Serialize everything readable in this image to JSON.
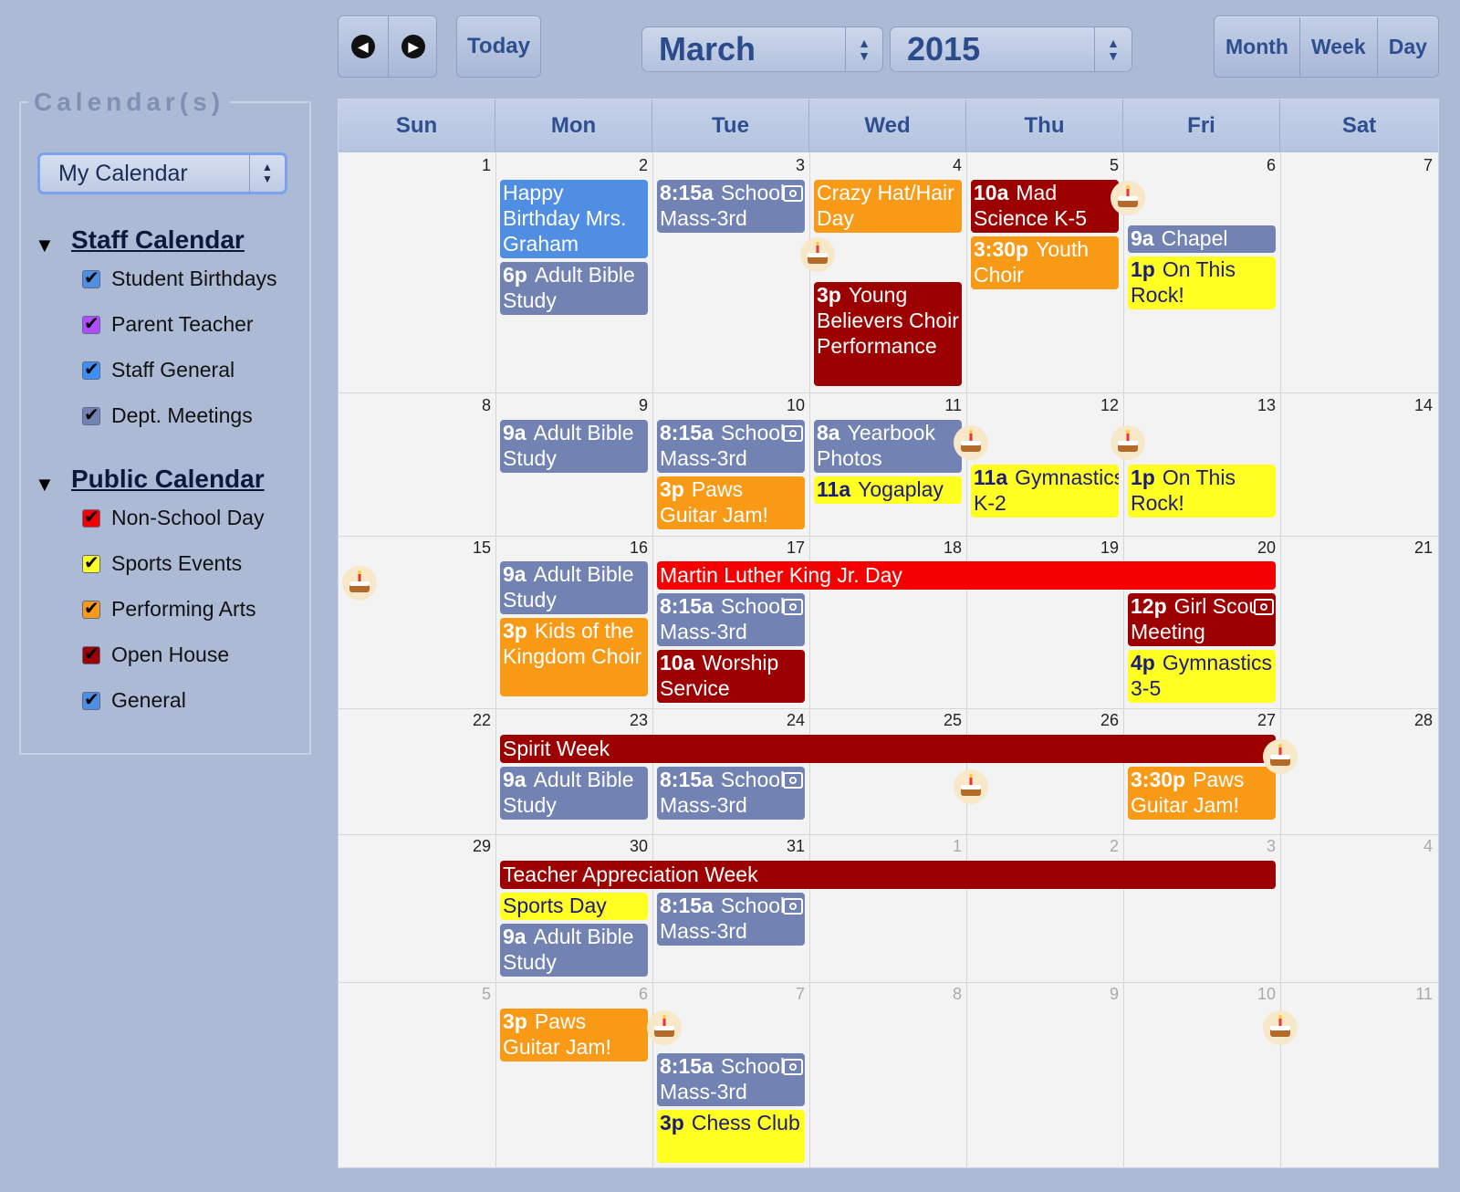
{
  "toolbar": {
    "prev_icon": "chevron-left-icon",
    "next_icon": "chevron-right-icon",
    "today_label": "Today",
    "month_value": "March",
    "year_value": "2015",
    "views": [
      "Month",
      "Week",
      "Day"
    ]
  },
  "sidebar": {
    "legend": "Calendar(s)",
    "calendar_select": "My Calendar",
    "groups": [
      {
        "title": "Staff Calendar",
        "items": [
          {
            "label": "Student Birthdays",
            "color": "#4f8ee3"
          },
          {
            "label": "Parent Teacher",
            "color": "#b14cff"
          },
          {
            "label": "Staff General",
            "color": "#3f8ef5"
          },
          {
            "label": "Dept. Meetings",
            "color": "#7182b3"
          }
        ]
      },
      {
        "title": "Public Calendar",
        "items": [
          {
            "label": "Non-School Day",
            "color": "#f40000"
          },
          {
            "label": "Sports Events",
            "color": "#ffff21"
          },
          {
            "label": "Performing Arts",
            "color": "#f99a16"
          },
          {
            "label": "Open House",
            "color": "#9c0000"
          },
          {
            "label": "General",
            "color": "#4f8ee3"
          }
        ]
      }
    ]
  },
  "calendar": {
    "weekdays": [
      "Sun",
      "Mon",
      "Tue",
      "Wed",
      "Thu",
      "Fri",
      "Sat"
    ],
    "weeks": [
      [
        "1",
        "2",
        "3",
        "4",
        "5",
        "6",
        "7"
      ],
      [
        "8",
        "9",
        "10",
        "11",
        "12",
        "13",
        "14"
      ],
      [
        "15",
        "16",
        "17",
        "18",
        "19",
        "20",
        "21"
      ],
      [
        "22",
        "23",
        "24",
        "25",
        "26",
        "27",
        "28"
      ],
      [
        "29",
        "30",
        "31",
        "1",
        "2",
        "3",
        "4"
      ],
      [
        "5",
        "6",
        "7",
        "8",
        "9",
        "10",
        "11"
      ]
    ],
    "events": {
      "w1_mon_1": {
        "time": "",
        "title": "Happy Birthday Mrs. Graham"
      },
      "w1_mon_2": {
        "time": "6p",
        "title": "Adult Bible Study"
      },
      "w1_tue_1": {
        "time": "8:15a",
        "title": "School Mass-3rd"
      },
      "w1_wed_1": {
        "time": "",
        "title": "Crazy Hat/Hair Day"
      },
      "w1_wed_2": {
        "time": "3p",
        "title": "Young Believers Choir Performance"
      },
      "w1_thu_1": {
        "time": "10a",
        "title": "Mad Science K-5"
      },
      "w1_thu_2": {
        "time": "3:30p",
        "title": "Youth Choir"
      },
      "w1_fri_1": {
        "time": "9a",
        "title": "Chapel"
      },
      "w1_fri_2": {
        "time": "1p",
        "title": "On This Rock!"
      },
      "w2_mon_1": {
        "time": "9a",
        "title": "Adult Bible Study"
      },
      "w2_tue_1": {
        "time": "8:15a",
        "title": "School Mass-3rd"
      },
      "w2_tue_2": {
        "time": "3p",
        "title": "Paws Guitar Jam!"
      },
      "w2_wed_1": {
        "time": "8a",
        "title": "Yearbook Photos"
      },
      "w2_wed_2": {
        "time": "11a",
        "title": "Yogaplay"
      },
      "w2_thu_1": {
        "time": "11a",
        "title": "Gymnastics K-2"
      },
      "w2_fri_1": {
        "time": "1p",
        "title": "On This Rock!"
      },
      "w3_mlk": {
        "time": "",
        "title": "Martin Luther King Jr. Day"
      },
      "w3_mon_1": {
        "time": "9a",
        "title": "Adult Bible Study"
      },
      "w3_mon_2": {
        "time": "3p",
        "title": "Kids of the Kingdom Choir"
      },
      "w3_tue_1": {
        "time": "8:15a",
        "title": "School Mass-3rd"
      },
      "w3_tue_2": {
        "time": "10a",
        "title": "Worship Service"
      },
      "w3_fri_1": {
        "time": "12p",
        "title": "Girl Scout Meeting"
      },
      "w3_fri_2": {
        "time": "4p",
        "title": "Gymnastics 3-5"
      },
      "w4_spirit": {
        "time": "",
        "title": "Spirit Week"
      },
      "w4_mon_1": {
        "time": "9a",
        "title": "Adult Bible Study"
      },
      "w4_tue_1": {
        "time": "8:15a",
        "title": "School Mass-3rd"
      },
      "w4_fri_1": {
        "time": "3:30p",
        "title": "Paws Guitar Jam!"
      },
      "w5_teacher": {
        "time": "",
        "title": "Teacher Appreciation Week"
      },
      "w5_mon_1": {
        "time": "",
        "title": "Sports Day"
      },
      "w5_mon_2": {
        "time": "9a",
        "title": "Adult Bible Study"
      },
      "w5_tue_1": {
        "time": "8:15a",
        "title": "School Mass-3rd"
      },
      "w6_mon_1": {
        "time": "3p",
        "title": "Paws Guitar Jam!"
      },
      "w6_tue_1": {
        "time": "8:15a",
        "title": "School Mass-3rd"
      },
      "w6_tue_2": {
        "time": "3p",
        "title": "Chess Club"
      }
    }
  }
}
